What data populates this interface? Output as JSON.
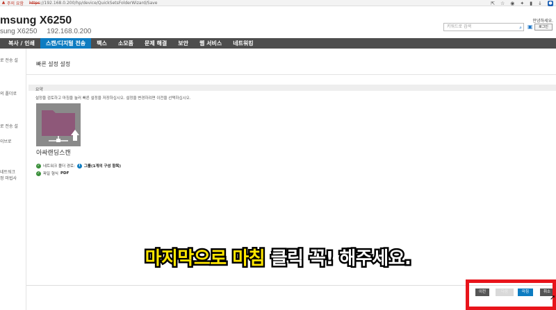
{
  "browser": {
    "warning_label": "주의 요함",
    "url_scheme": "https",
    "url_rest": "://192.168.0.200/hp/device/QuickSetsFolderWizard/Save"
  },
  "header": {
    "model": "msung X6250",
    "model_sub": "sung X6250",
    "ip": "192.168.0.200",
    "greeting": "안녕하세요.",
    "search_placeholder": "키워드로 검색",
    "login_label": "로그인"
  },
  "nav": {
    "items": [
      "복사 / 인쇄",
      "스캔/디지털 전송",
      "팩스",
      "소모품",
      "문제 해결",
      "보안",
      "웹 서비스",
      "네트워킹"
    ],
    "active_index": 1
  },
  "sidebar": {
    "items": [
      "로 전송 설",
      "의 폴더로",
      "로 전송 설",
      "이브로",
      "네트워크",
      "정 마법사"
    ]
  },
  "main": {
    "title": "빠른 설정 설정",
    "section": "요약",
    "description": "설정을 검토하고 마침을 눌러 빠른 설정을 저장하십시오. 설정을 변경하려면 이전을 선택하십시오.",
    "quickset_name": "아싸랜딩스캔",
    "summary": {
      "folder_label": "네트워크 폴더 경로:",
      "folder_value": "그룹(1개의 구성 항목)",
      "format_label": "파일 형식",
      "format_value": "PDF"
    }
  },
  "buttons": {
    "prev": "이전",
    "next": "다음",
    "finish": "마침",
    "cancel": "취소"
  },
  "caption": {
    "yellow": "마지막으로 마침",
    "white": "클릭 꼭! 해주세요."
  },
  "colors": {
    "nav_active": "#0d7cc1",
    "nav_bg": "#4d4d4d",
    "highlight": "#e8141b",
    "folder_icon": "#8e5879",
    "caption_yellow": "#ffe600"
  }
}
